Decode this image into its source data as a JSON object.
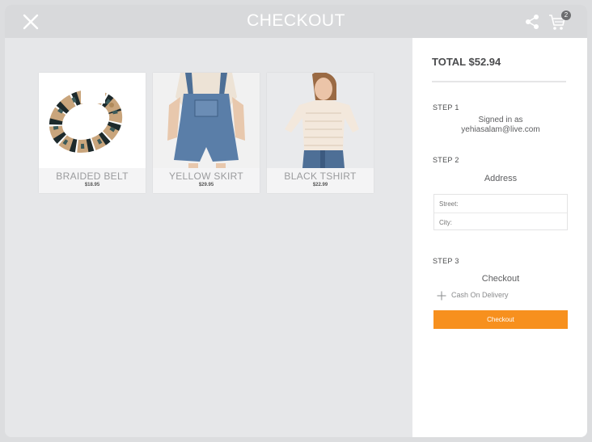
{
  "header": {
    "title": "CHECKOUT",
    "cart_count": "2",
    "icons": {
      "close": "close-icon",
      "share": "share-icon",
      "cart": "cart-icon"
    }
  },
  "products": [
    {
      "name": "BRAIDED BELT",
      "price": "$18.95",
      "image": "beaded-necklace"
    },
    {
      "name": "YELLOW SKIRT",
      "price": "$29.95",
      "image": "denim-overalls"
    },
    {
      "name": "BLACK TSHIRT",
      "price": "$22.99",
      "image": "knit-sweater"
    }
  ],
  "summary": {
    "total": "TOTAL $52.94",
    "step1": {
      "label": "STEP 1",
      "line1": "Signed in as",
      "line2": "yehiasalam@live.com"
    },
    "step2": {
      "label": "STEP 2",
      "title": "Address",
      "street_placeholder": "Street:",
      "city_placeholder": "City:"
    },
    "step3": {
      "label": "STEP 3",
      "title": "Checkout",
      "payment_option": "Cash On Delivery",
      "button": "Checkout"
    }
  },
  "colors": {
    "accent": "#f7901e",
    "header_bg": "#d8d9db",
    "page_bg": "#e6e7e9"
  }
}
